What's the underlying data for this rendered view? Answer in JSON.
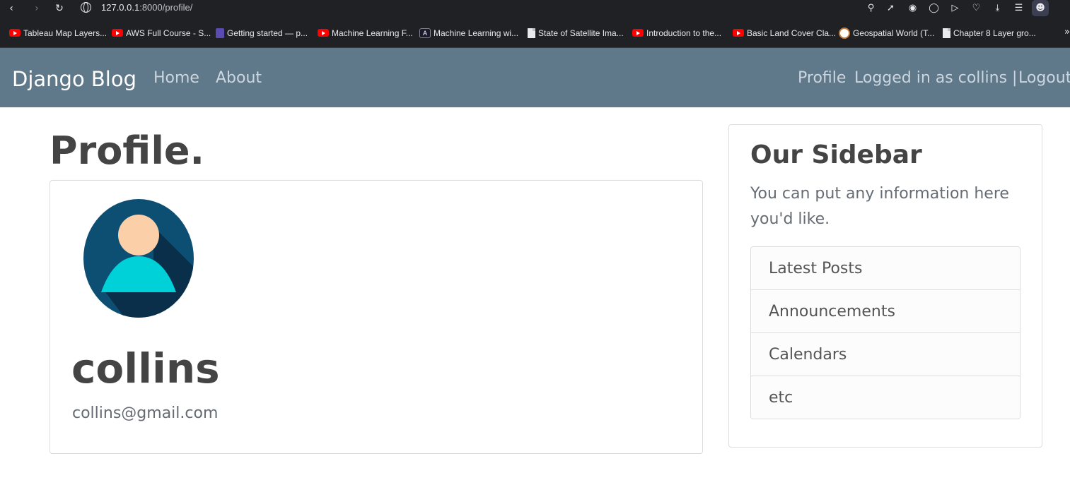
{
  "browser": {
    "url_host": "127.0.0.1",
    "url_path": ":8000/profile/",
    "bookmarks": [
      {
        "label": "Tableau Map Layers...",
        "icon": "youtube-icon"
      },
      {
        "label": "AWS Full Course - S...",
        "icon": "youtube-icon"
      },
      {
        "label": "Getting started — p...",
        "icon": "pyscript-icon"
      },
      {
        "label": "Machine Learning F...",
        "icon": "youtube-icon"
      },
      {
        "label": "Machine Learning wi...",
        "icon": "ml-icon"
      },
      {
        "label": "State of Satellite Ima...",
        "icon": "document-icon"
      },
      {
        "label": "Introduction to the...",
        "icon": "youtube-icon"
      },
      {
        "label": "Basic Land Cover Cla...",
        "icon": "youtube-icon"
      },
      {
        "label": "Geospatial World (T...",
        "icon": "geospatial-icon"
      },
      {
        "label": "Chapter 8 Layer gro...",
        "icon": "document-icon"
      }
    ]
  },
  "navbar": {
    "brand": "Django Blog",
    "home": "Home",
    "about": "About",
    "profile": "Profile",
    "logged_in": "Logged in as collins |",
    "logout": "Logout"
  },
  "main": {
    "title": "Profile.",
    "username": "collins",
    "email": "collins@gmail.com"
  },
  "sidebar": {
    "title": "Our Sidebar",
    "text": "You can put any information here you'd like.",
    "items": [
      "Latest Posts",
      "Announcements",
      "Calendars",
      "etc"
    ]
  },
  "colors": {
    "navbar": "#5f788a",
    "avatar_bg": "#0d4f73",
    "avatar_body": "#00d0d8",
    "avatar_skin": "#fbd0a8"
  }
}
